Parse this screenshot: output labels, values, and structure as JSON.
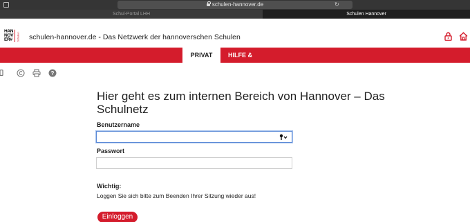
{
  "browser": {
    "url": "schulen-hannover.de",
    "tabs": [
      {
        "label": "Schul-Portal LHH",
        "active": false
      },
      {
        "label": "Schulen Hannover",
        "active": true
      }
    ]
  },
  "header": {
    "logo_text": "HAN\nNOV\nER#",
    "logo_side_text": "Schulen",
    "site_title": "schulen-hannover.de - Das Netzwerk der hannoverschen Schulen",
    "icons": [
      "lock-icon",
      "home-icon"
    ],
    "accent_color": "#d41c2c"
  },
  "nav": {
    "items": [
      {
        "label": "PRIVAT",
        "active": true
      },
      {
        "label": "HILFE & SUPPORT",
        "active": false
      }
    ]
  },
  "tools": [
    "mobile-icon",
    "copyright-icon",
    "print-icon",
    "help-icon"
  ],
  "main": {
    "heading": "Hier geht es zum internen Bereich von Hannover – Das Schulnetz",
    "username_label": "Benutzername",
    "username_value": "",
    "password_label": "Passwort",
    "password_value": "",
    "important_title": "Wichtig:",
    "important_text": "Loggen Sie sich bitte zum Beenden Ihrer Sitzung wieder aus!",
    "login_button": "Einloggen"
  }
}
